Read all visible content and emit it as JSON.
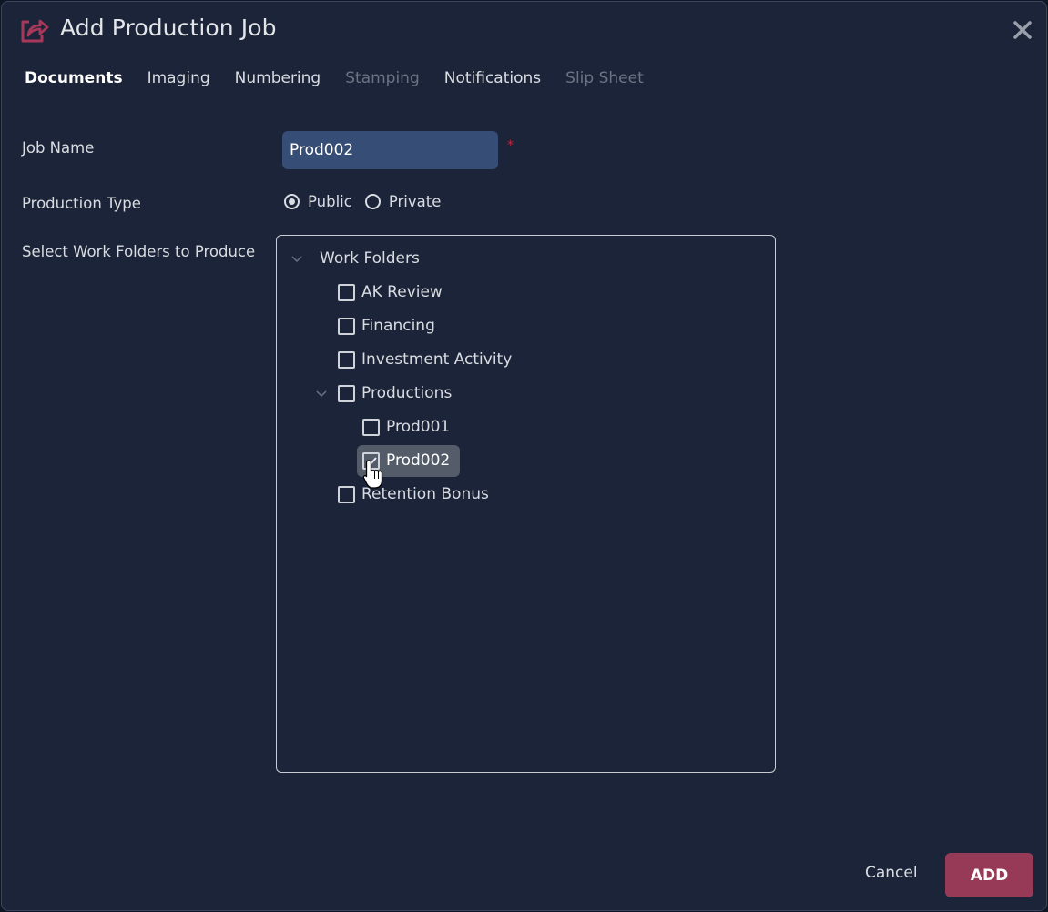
{
  "dialog": {
    "title": "Add Production Job",
    "title_icon": "share-export-icon",
    "close_icon": "close-icon",
    "accent_color": "#963a58"
  },
  "tabs": [
    {
      "label": "Documents",
      "state": "active"
    },
    {
      "label": "Imaging",
      "state": "enabled"
    },
    {
      "label": "Numbering",
      "state": "enabled"
    },
    {
      "label": "Stamping",
      "state": "disabled"
    },
    {
      "label": "Notifications",
      "state": "enabled"
    },
    {
      "label": "Slip Sheet",
      "state": "disabled"
    }
  ],
  "form": {
    "job_name_label": "Job Name",
    "job_name_value": "Prod002",
    "required_marker": "*",
    "production_type_label": "Production Type",
    "production_type_options": [
      {
        "label": "Public",
        "checked": true
      },
      {
        "label": "Private",
        "checked": false
      }
    ],
    "work_folders_label": "Select Work Folders to Produce"
  },
  "tree": {
    "root": {
      "label": "Work Folders",
      "expanded": true
    },
    "items": [
      {
        "label": "AK Review",
        "checked": false,
        "level": 1
      },
      {
        "label": "Financing",
        "checked": false,
        "level": 1
      },
      {
        "label": "Investment Activity",
        "checked": false,
        "level": 1
      },
      {
        "label": "Productions",
        "checked": false,
        "level": 1,
        "expanded": true
      },
      {
        "label": "Prod001",
        "checked": false,
        "level": 2
      },
      {
        "label": "Prod002",
        "checked": true,
        "level": 2,
        "hovered": true
      },
      {
        "label": "Retention Bonus",
        "checked": false,
        "level": 1
      }
    ]
  },
  "footer": {
    "cancel_label": "Cancel",
    "add_label": "ADD"
  }
}
